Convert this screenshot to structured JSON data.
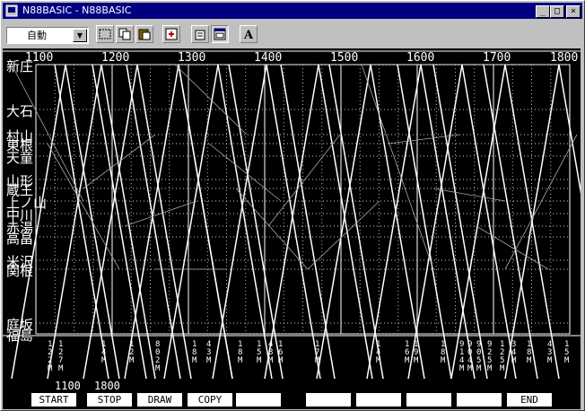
{
  "window": {
    "title": "N88BASIC - N88BASIC",
    "controls": [
      "_",
      "□",
      "×"
    ]
  },
  "toolbar": {
    "mode_value": "自動"
  },
  "diagram": {
    "time_labels": [
      "1100",
      "1200",
      "1300",
      "1400",
      "1500",
      "1600",
      "1700",
      "1800"
    ],
    "stations": [
      {
        "name": "新庄",
        "label": "新庄"
      },
      {
        "name": "大石田",
        "label": "大石"
      },
      {
        "name": "村山",
        "label": "村山"
      },
      {
        "name": "東根",
        "label": "東根"
      },
      {
        "name": "天童",
        "label": "天童"
      },
      {
        "name": "山形",
        "label": "山形"
      },
      {
        "name": "蔵王",
        "label": "蔵王"
      },
      {
        "name": "上ノ山",
        "label": "上ノ山"
      },
      {
        "name": "中川",
        "label": "中川"
      },
      {
        "name": "赤湯",
        "label": "赤湯"
      },
      {
        "name": "高畠",
        "label": "高畠"
      },
      {
        "name": "米沢",
        "label": "米沢"
      },
      {
        "name": "関根",
        "label": "関根"
      },
      {
        "name": "庭坂",
        "label": "庭坂"
      },
      {
        "name": "福島",
        "label": "福島"
      }
    ],
    "train_labels": [
      "1\n2\n2\nM",
      "1\n2\n7\nM",
      "1\n4\nM",
      "1\n2\nM",
      "8\n0\n2\nM",
      "1\n8\nM",
      "4\n3\nM",
      "1\n8\nM",
      "1\n5\nM",
      "4\n8\nM",
      "1\n6\nM",
      "1\n7\nM",
      "1\n4\nM",
      "1\n6\nM",
      "1\n9\nM",
      "1\n8\nM",
      "9\n1\n4\nM",
      "9\n0\n4\nM",
      "9\n0\n5\nM",
      "9\n2\n5\nM",
      "1\n2\n5\nM",
      "3\n4\nM",
      "1\n8\nM",
      "4\n3\nM",
      "1\n5\nM"
    ]
  },
  "range": {
    "start": "1100",
    "stop": "1800"
  },
  "function_keys": [
    "START",
    "STOP",
    "DRAW",
    "COPY",
    "",
    "",
    "",
    "",
    "",
    "END"
  ],
  "colors": {
    "titlebar": "#000080",
    "screen": "#000000",
    "line": "#ffffff",
    "face": "#c0c0c0"
  }
}
